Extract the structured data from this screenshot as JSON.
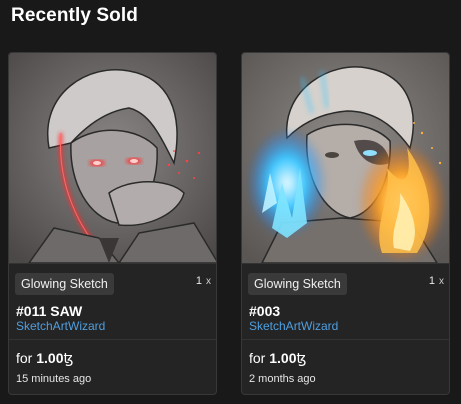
{
  "section": {
    "title": "Recently Sold"
  },
  "cards": [
    {
      "tag": "Glowing Sketch",
      "quantity": "1",
      "quantity_suffix": "x",
      "name": "#011 SAW",
      "creator": "SketchArtWizard",
      "price_prefix": "for",
      "price": "1.00",
      "currency": "ꜩ",
      "time": "15 minutes ago",
      "artwork_glow_color": "#ff2a2a"
    },
    {
      "tag": "Glowing Sketch",
      "quantity": "1",
      "quantity_suffix": "x",
      "name": "#003",
      "creator": "SketchArtWizard",
      "price_prefix": "for",
      "price": "1.00",
      "currency": "ꜩ",
      "time": "2 months ago",
      "artwork_glow_colors": [
        "#3ec8ff",
        "#ffaa2a"
      ]
    }
  ]
}
